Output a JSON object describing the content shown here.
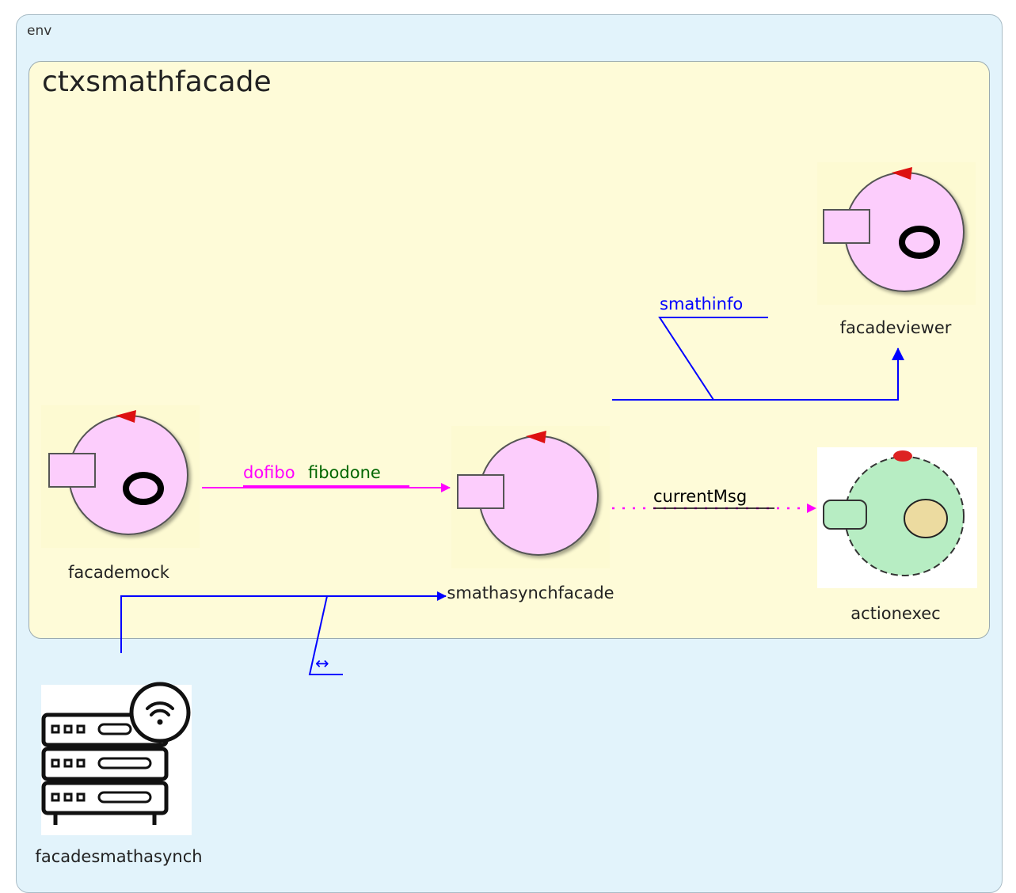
{
  "containers": {
    "env_label": "env",
    "context_label": "ctxsmathfacade"
  },
  "nodes": {
    "facademock": "facademock",
    "smathasynchfacade": "smathasynchfacade",
    "facadeviewer": "facadeviewer",
    "actionexec": "actionexec",
    "facadesmathasynch": "facadesmathasynch"
  },
  "links": {
    "dofibo": "dofibo",
    "fibodone": "fibodone",
    "currentMsg": "currentMsg",
    "smathinfo": "smathinfo",
    "bidirectional": "↔"
  },
  "colors": {
    "env_bg": "#e2f3fb",
    "context_bg": "#fefbd8",
    "actor_fill": "#fccdfc",
    "exec_fill": "#b7edc3",
    "request_link": "#ff00ff",
    "response_label": "#006600",
    "dispatch_link": "#0000ff",
    "token_red": "#dd1111",
    "token_tan": "#ecdba0"
  },
  "icons": {
    "actor": "actor-circle-icon",
    "exec": "exec-circle-icon",
    "server": "server-rack-wifi-icon"
  }
}
